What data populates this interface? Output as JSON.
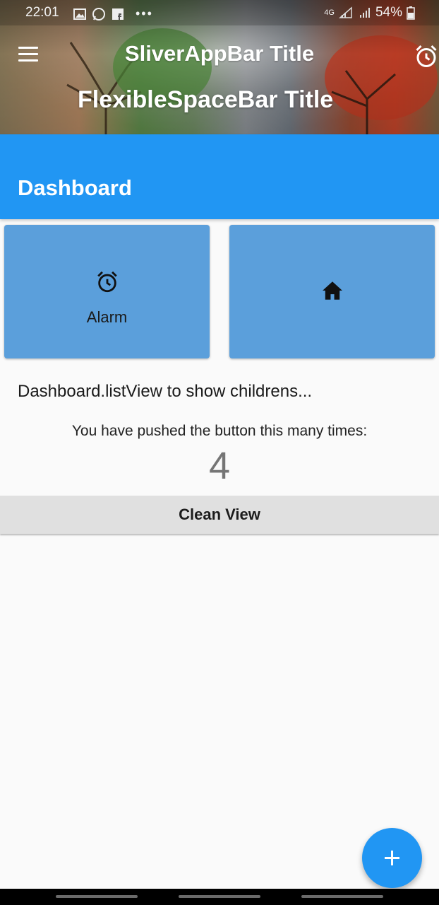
{
  "status_bar": {
    "time": "22:01",
    "network": "4G",
    "battery": "54%",
    "notification_icons": [
      "image-icon",
      "whatsapp-icon",
      "facebook-icon",
      "more-dots-icon"
    ]
  },
  "app_bar": {
    "title": "SliverAppBar Title",
    "flexible_title": "FlexibleSpaceBar Title",
    "menu_icon": "menu-icon",
    "action_icon": "alarm-icon"
  },
  "dashboard": {
    "title": "Dashboard",
    "cards": [
      {
        "icon": "alarm-icon",
        "label": "Alarm"
      },
      {
        "icon": "home-icon",
        "label": ""
      }
    ],
    "list_text": "Dashboard.listView to show childrens...",
    "pushed_text": "You have pushed the button this many times:",
    "counter": "4",
    "clean_button": "Clean View"
  },
  "fab": {
    "icon": "plus-icon"
  },
  "colors": {
    "primary": "#2196f3",
    "card": "#5b9fdb",
    "background": "#fafafa",
    "button": "#e0e0e0"
  }
}
